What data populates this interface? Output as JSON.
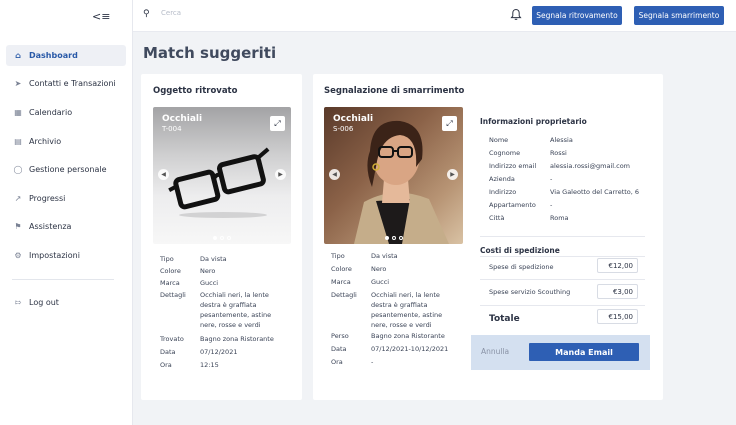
{
  "sidebar": {
    "items": [
      {
        "label": "Dashboard",
        "icon": "home-icon"
      },
      {
        "label": "Contatti e Transazioni",
        "icon": "send-icon"
      },
      {
        "label": "Calendario",
        "icon": "calendar-icon"
      },
      {
        "label": "Archivio",
        "icon": "archive-icon"
      },
      {
        "label": "Gestione personale",
        "icon": "user-icon"
      },
      {
        "label": "Progressi",
        "icon": "trend-icon"
      },
      {
        "label": "Assistenza",
        "icon": "flag-icon"
      },
      {
        "label": "Impostazioni",
        "icon": "wrench-icon"
      }
    ],
    "logout": "Log out"
  },
  "topbar": {
    "search_placeholder": "Cerca",
    "btn_found": "Segnala ritrovamento",
    "btn_lost": "Segnala smarrimento"
  },
  "page": {
    "title": "Match suggeriti"
  },
  "found": {
    "card_title": "Oggetto ritrovato",
    "photo_title": "Occhiali",
    "photo_code": "T-004",
    "details": [
      {
        "k": "Tipo",
        "v": "Da vista"
      },
      {
        "k": "Colore",
        "v": "Nero"
      },
      {
        "k": "Marca",
        "v": "Gucci"
      },
      {
        "k": "Dettagli",
        "v": "Occhiali neri, la lente destra è graffiata pesantemente, astine nere, rosse e verdi"
      },
      {
        "k": "Trovato",
        "v": "Bagno zona Ristorante"
      },
      {
        "k": "Data",
        "v": "07/12/2021"
      },
      {
        "k": "Ora",
        "v": "12:15"
      }
    ]
  },
  "lost": {
    "card_title": "Segnalazione di smarrimento",
    "photo_title": "Occhiali",
    "photo_code": "S-006",
    "details": [
      {
        "k": "Tipo",
        "v": "Da vista"
      },
      {
        "k": "Colore",
        "v": "Nero"
      },
      {
        "k": "Marca",
        "v": "Gucci"
      },
      {
        "k": "Dettagli",
        "v": "Occhiali neri, la lente destra è graffiata pesantemente, astine nere, rosse e verdi"
      },
      {
        "k": "Perso",
        "v": "Bagno zona Ristorante"
      },
      {
        "k": "Data",
        "v": "07/12/2021-10/12/2021"
      },
      {
        "k": "Ora",
        "v": "-"
      }
    ]
  },
  "owner": {
    "title": "Informazioni proprietario",
    "rows": [
      {
        "k": "Nome",
        "v": "Alessia"
      },
      {
        "k": "Cognome",
        "v": "Rossi"
      },
      {
        "k": "Indirizzo email",
        "v": "alessia.rossi@gmail.com"
      },
      {
        "k": "Azienda",
        "v": "-"
      },
      {
        "k": "Indirizzo",
        "v": "Via Galeotto del Carretto, 6"
      },
      {
        "k": "Appartamento",
        "v": "-"
      },
      {
        "k": "Città",
        "v": "Roma"
      }
    ]
  },
  "shipping": {
    "title": "Costi di spedizione",
    "shipping_label": "Spese di spedizione",
    "shipping_value": "€12,00",
    "service_label": "Spese servizio Scouthing",
    "service_value": "€3,00",
    "total_label": "Totale",
    "total_value": "€15,00"
  },
  "actions": {
    "cancel": "Annulla",
    "send": "Manda Email"
  },
  "colors": {
    "accent": "#2e5fb4",
    "active_bg": "#eef0f5",
    "action_bar": "#d4e0f0"
  }
}
